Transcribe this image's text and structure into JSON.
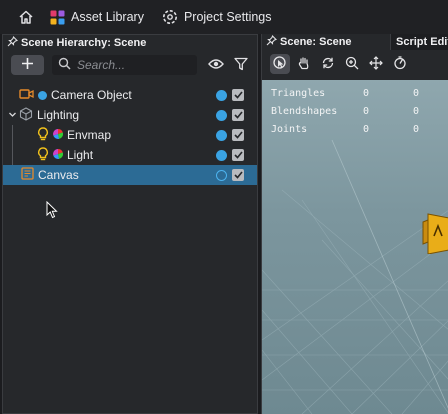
{
  "topbar": {
    "asset_library_label": "Asset Library",
    "project_settings_label": "Project Settings"
  },
  "hierarchy": {
    "title": "Scene Hierarchy: Scene",
    "search_placeholder": "Search...",
    "items": [
      {
        "label": "Camera Object"
      },
      {
        "label": "Lighting"
      },
      {
        "label": "Envmap"
      },
      {
        "label": "Light"
      },
      {
        "label": "Canvas"
      }
    ]
  },
  "scene": {
    "tab_title": "Scene: Scene",
    "other_tab": "Script Edit",
    "stats": [
      {
        "label": "Triangles",
        "a": "0",
        "b": "0"
      },
      {
        "label": "Blendshapes",
        "a": "0",
        "b": "0"
      },
      {
        "label": "Joints",
        "a": "0",
        "b": "0"
      }
    ]
  },
  "colors": {
    "accent": "#3aa3e3",
    "selected_row": "#2c6b95",
    "camera_icon": "#e58a2b",
    "light_icon": "#f2c21b",
    "viewport": "#7c969e"
  }
}
